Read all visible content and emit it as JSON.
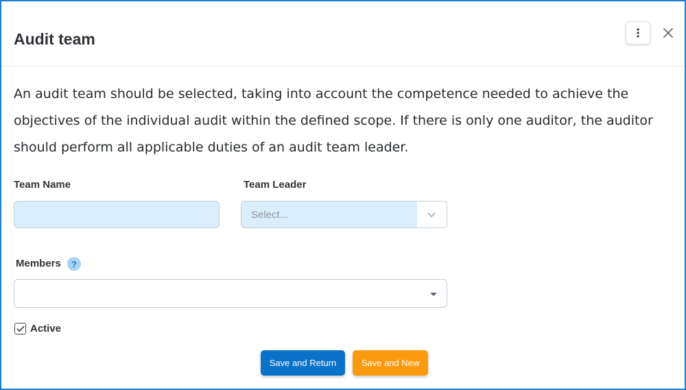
{
  "dialog": {
    "title": "Audit team",
    "more_options_icon": "kebab-vertical-icon",
    "close_icon": "close-icon"
  },
  "description": "An audit team should be selected, taking into account the competence needed to achieve the objectives of the individual audit within the defined scope. If there is only one auditor, the auditor should perform all applicable duties of an audit team leader.",
  "form": {
    "team_name": {
      "label": "Team Name",
      "value": ""
    },
    "team_leader": {
      "label": "Team Leader",
      "placeholder": "Select..."
    },
    "members": {
      "label": "Members",
      "help_text": "?",
      "value": ""
    },
    "active": {
      "label": "Active",
      "checked": true
    }
  },
  "actions": {
    "save_return": "Save and Return",
    "save_new": "Save and New"
  },
  "colors": {
    "border": "#1b7fd1",
    "primary_button": "#0a72c9",
    "secondary_button": "#fc9a0f",
    "input_fill": "#dbeefd"
  }
}
